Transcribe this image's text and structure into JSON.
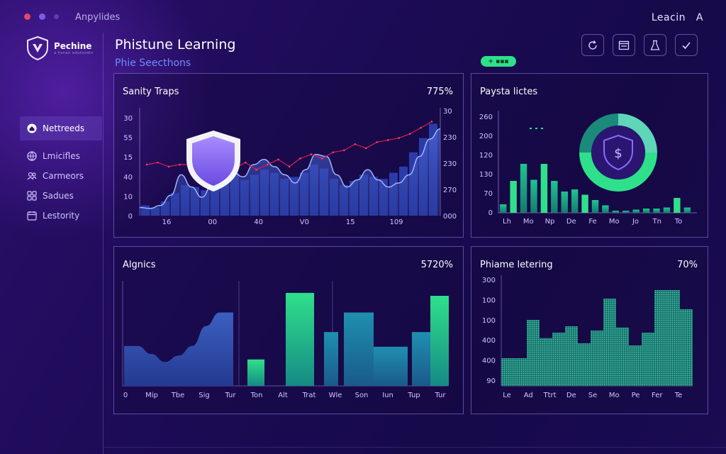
{
  "window": {
    "title": "Anpylides"
  },
  "user": {
    "name": "Leacin",
    "initial": "A"
  },
  "sidebar": {
    "logo": {
      "name": "Pechine",
      "tagline": "a hunan edutoodin"
    },
    "items": [
      {
        "label": "Nettreeds",
        "icon": "house-icon",
        "active": true
      },
      {
        "label": "Lmicifles",
        "icon": "globe-icon"
      },
      {
        "label": "Carmeors",
        "icon": "people-icon"
      },
      {
        "label": "Sadues",
        "icon": "apps-icon"
      },
      {
        "label": "Lestority",
        "icon": "calendar-icon"
      }
    ]
  },
  "header": {
    "title": "Phistune Learning",
    "subtitle": "Phie Seecthons",
    "badge": "+ ▪▪▪"
  },
  "toolbar": {
    "buttons": [
      "refresh-icon",
      "window-icon",
      "lab-flask-icon",
      "check-icon"
    ]
  },
  "colors": {
    "accent": "#2fe08a",
    "blue": "#3a57c4",
    "line": "#d8204a"
  },
  "panels": {
    "sanity": {
      "title": "Sanity Traps",
      "value": "775%"
    },
    "payste": {
      "title": "Paysta lictes"
    },
    "algnics": {
      "title": "Algnics",
      "value": "5720%"
    },
    "phiame": {
      "title": "Phiame letering",
      "value": "70%"
    }
  },
  "chart_data": [
    {
      "type": "area",
      "title": "Sanity Traps",
      "annotation": "775%",
      "y_left_ticks": [
        "30",
        "55",
        "15",
        "40",
        "10",
        "0"
      ],
      "y_right_ticks": [
        "30",
        "230",
        "230",
        "270",
        "000"
      ],
      "x_ticks": [
        "16",
        "00",
        "40",
        "V0",
        "15",
        "109"
      ],
      "area": [
        0.08,
        0.07,
        0.1,
        0.2,
        0.4,
        0.28,
        0.18,
        0.3,
        0.45,
        0.42,
        0.38,
        0.5,
        0.55,
        0.48,
        0.4,
        0.32,
        0.45,
        0.6,
        0.58,
        0.4,
        0.28,
        0.35,
        0.45,
        0.35,
        0.28,
        0.32,
        0.4,
        0.58,
        0.75,
        0.85
      ],
      "bars": [
        0.1,
        0.08,
        0.14,
        0.22,
        0.3,
        0.28,
        0.25,
        0.3,
        0.38,
        0.42,
        0.35,
        0.4,
        0.45,
        0.42,
        0.36,
        0.38,
        0.42,
        0.5,
        0.46,
        0.36,
        0.3,
        0.34,
        0.4,
        0.38,
        0.36,
        0.42,
        0.48,
        0.62,
        0.76,
        0.9
      ],
      "line": [
        0.5,
        0.52,
        0.48,
        0.5,
        0.5,
        0.52,
        0.55,
        0.5,
        0.46,
        0.52,
        0.45,
        0.5,
        0.55,
        0.48,
        0.56,
        0.6,
        0.56,
        0.62,
        0.64,
        0.7,
        0.66,
        0.72,
        0.74,
        0.76,
        0.8,
        0.86,
        0.92
      ]
    },
    {
      "type": "bar",
      "title": "Paysta lictes",
      "y_ticks": [
        "260",
        "200",
        "120",
        "130",
        "70",
        "0"
      ],
      "x_ticks": [
        "Lh",
        "Mo",
        "Np",
        "De",
        "Fe",
        "Mo",
        "Jo",
        "Tn",
        "To"
      ],
      "values": [
        0.08,
        0.3,
        0.46,
        0.31,
        0.46,
        0.3,
        0.2,
        0.22,
        0.17,
        0.12,
        0.07,
        0.02,
        0.02,
        0.03,
        0.04,
        0.04,
        0.05,
        0.14,
        0.05
      ],
      "highlight": [
        1,
        4,
        8,
        17
      ],
      "donut": {
        "shares": [
          0.25,
          0.5,
          0.25
        ],
        "symbol": "$"
      }
    },
    {
      "type": "area",
      "title": "Algnics",
      "annotation": "5720%",
      "x_ticks": [
        "0",
        "Mip",
        "Tbe",
        "Sig",
        "Tur",
        "Ton",
        "Alt",
        "Trat",
        "Wle",
        "Son",
        "Iun",
        "Tup",
        "Tur"
      ],
      "area": [
        0.5,
        0.5,
        0.4,
        0.3,
        0.38,
        0.5,
        0.75,
        0.92,
        0.92
      ],
      "bars": [
        {
          "h": 0.27,
          "green": true
        },
        {
          "h": 0.95,
          "green": true
        },
        {
          "h": 0.55,
          "green": false
        },
        {
          "h": 0.75,
          "green": false
        },
        {
          "h": 0.4,
          "green": false
        },
        {
          "h": 0.55,
          "green": false
        },
        {
          "h": 0.92,
          "green": true
        }
      ]
    },
    {
      "type": "area",
      "title": "Phiame letering",
      "annotation": "70%",
      "y_ticks": [
        "300",
        "100",
        "100",
        "400",
        "400",
        "90"
      ],
      "x_ticks": [
        "Le",
        "Ad",
        "Ttrt",
        "De",
        "Se",
        "Mo",
        "Pe",
        "Fer",
        "Te"
      ],
      "steps": [
        0.26,
        0.26,
        0.62,
        0.45,
        0.5,
        0.56,
        0.4,
        0.52,
        0.82,
        0.55,
        0.38,
        0.5,
        0.9,
        0.9,
        0.72
      ]
    }
  ]
}
